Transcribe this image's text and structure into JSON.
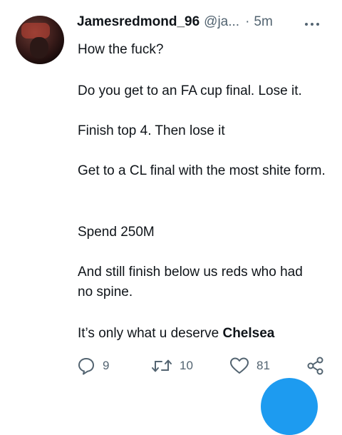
{
  "tweet": {
    "display_name": "Jamesredmond_96",
    "handle": "@ja...",
    "separator": "·",
    "time": "5m",
    "paragraphs": [
      "How the fuck?",
      "Do you get to an FA cup final. Lose it.",
      "Finish top 4. Then lose it",
      "Get to a CL final with the most shite form.",
      "Spend 250M",
      "And still finish below us reds who had no spine.",
      "It’s only what u deserve "
    ],
    "final_bold": "Chelsea"
  },
  "actions": {
    "replies": "9",
    "retweets": "10",
    "likes": "81"
  },
  "icons": {
    "reply": "reply-icon",
    "retweet": "retweet-icon",
    "like": "heart-icon",
    "share": "share-icon",
    "more": "more-options-icon"
  },
  "colors": {
    "text": "#0f1419",
    "secondary": "#536471",
    "accent": "#1d9bf0",
    "background": "#ffffff"
  }
}
